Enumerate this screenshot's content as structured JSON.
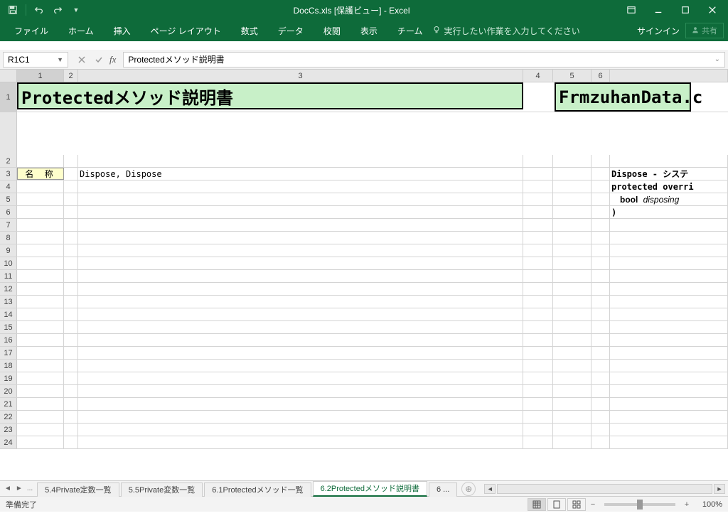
{
  "title": "DocCs.xls  [保護ビュー] - Excel",
  "ribbon": {
    "tabs": [
      "ファイル",
      "ホーム",
      "挿入",
      "ページ レイアウト",
      "数式",
      "データ",
      "校閲",
      "表示",
      "チーム"
    ],
    "tellme": "実行したい作業を入力してください",
    "signin": "サインイン",
    "share": "共有"
  },
  "namebox": "R1C1",
  "formula": "Protectedメソッド説明書",
  "columns": [
    "1",
    "2",
    "3",
    "4",
    "5",
    "6"
  ],
  "rows_visible": [
    "1",
    "2",
    "3",
    "4",
    "5",
    "6",
    "7",
    "8",
    "9",
    "10",
    "11",
    "12",
    "13",
    "14",
    "15",
    "16",
    "17",
    "18",
    "19",
    "20",
    "21",
    "22",
    "23",
    "24"
  ],
  "cells": {
    "title_main": "Protectedメソッド説明書",
    "title_side": "FrmzuhanData.c",
    "r3c1": "名 称",
    "r3c2": "Dispose, Dispose",
    "r3c7a": "Dispose - システ",
    "r4c7a": "protected overri",
    "r5c7a": "bool",
    "r5c7b": "disposing",
    "r6c7": ")"
  },
  "sheets": {
    "list": [
      "5.4Private定数一覧",
      "5.5Private変数一覧",
      "6.1Protectedメソッド一覧",
      "6.2Protectedメソッド説明書",
      "6 ..."
    ],
    "active_index": 3,
    "ellipsis": "..."
  },
  "status": {
    "ready": "準備完了",
    "zoom": "100%"
  }
}
